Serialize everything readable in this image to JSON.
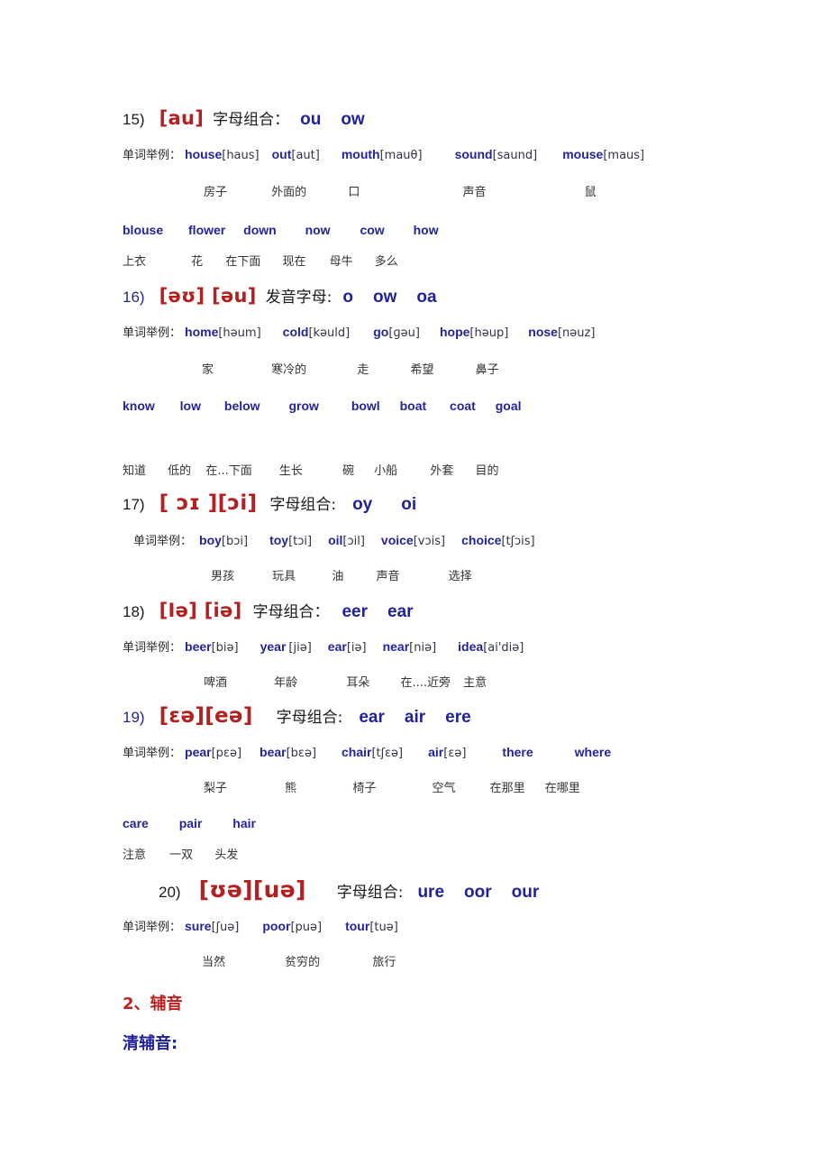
{
  "document": {
    "title": "英语音标 — 元音字母组合与辅音",
    "page_background": "#ffffff",
    "colors": {
      "ipa_red": "#b42020",
      "combo_blue": "#21219b",
      "word_blue": "#242498",
      "heading_red": "#c01f1f",
      "heading_blue": "#21219b",
      "gloss_gray": "#333333"
    },
    "examples_label": "单词举例："
  },
  "sections": [
    {
      "number": "15)",
      "number_color": "black",
      "ipa": "[au]",
      "label": "字母组合：",
      "combos": [
        "ou",
        "ow"
      ],
      "examples": [
        {
          "word": "house",
          "ipa": "[haus]"
        },
        {
          "word": "out",
          "ipa": "[aut]"
        },
        {
          "word": "mouth",
          "ipa": "[mauθ]"
        },
        {
          "word": "sound",
          "ipa": "[saund]"
        },
        {
          "word": "mouse",
          "ipa": "[maus]"
        }
      ],
      "glosses": [
        "房子",
        "外面的",
        "口",
        "声音",
        "鼠"
      ],
      "extra_words": [
        "blouse",
        "flower",
        "down",
        "now",
        "cow",
        "how"
      ],
      "extra_glosses": [
        "上衣",
        "花",
        "在下面",
        "现在",
        "母牛",
        "多么"
      ]
    },
    {
      "number": "16)",
      "number_color": "blue",
      "ipa": "[əʊ] [əu]",
      "label": "发音字母:",
      "combos": [
        "o",
        "ow",
        "oa"
      ],
      "examples": [
        {
          "word": "home",
          "ipa": "[həum]"
        },
        {
          "word": "cold",
          "ipa": "[kəuld]"
        },
        {
          "word": "go",
          "ipa": "[ɡəu]"
        },
        {
          "word": "hope",
          "ipa": "[həup]"
        },
        {
          "word": "nose",
          "ipa": "[nəuz]"
        }
      ],
      "glosses": [
        "家",
        "寒冷的",
        "走",
        "希望",
        "鼻子"
      ],
      "extra_words": [
        "know",
        "low",
        "below",
        "grow",
        "bowl",
        "boat",
        "coat",
        "goal"
      ],
      "extra_glosses": [
        "知道",
        "低的",
        "在...下面",
        "生长",
        "碗",
        "小船",
        "外套",
        "目的"
      ]
    },
    {
      "number": "17)",
      "number_color": "black",
      "ipa": "[ ɔɪ ][ɔi]",
      "label": "字母组合:",
      "combos": [
        "oy",
        "oi"
      ],
      "examples": [
        {
          "word": "boy",
          "ipa": "[bɔi]"
        },
        {
          "word": "toy",
          "ipa": "[tɔi]"
        },
        {
          "word": "oil",
          "ipa": "[ɔil]"
        },
        {
          "word": "voice",
          "ipa": "[vɔis]"
        },
        {
          "word": "choice",
          "ipa": "[tʃɔis]"
        }
      ],
      "glosses": [
        "男孩",
        "玩具",
        "油",
        "声音",
        "选择"
      ],
      "extra_words": [],
      "extra_glosses": []
    },
    {
      "number": "18)",
      "number_color": "black",
      "ipa": "[Iə] [iə]",
      "label": "字母组合：",
      "combos": [
        "eer",
        "ear"
      ],
      "examples": [
        {
          "word": "beer",
          "ipa": "[biə]"
        },
        {
          "word": "year",
          "ipa": "[jiə]"
        },
        {
          "word": "ear",
          "ipa": "[iə]"
        },
        {
          "word": "near",
          "ipa": "[niə]"
        },
        {
          "word": "idea",
          "ipa": "[ai'diə]"
        }
      ],
      "glosses": [
        "啤酒",
        "年龄",
        "耳朵",
        "在....近旁",
        "主意"
      ],
      "extra_words": [],
      "extra_glosses": []
    },
    {
      "number": "19)",
      "number_color": "blue",
      "ipa": "[ɛə][eə]",
      "label": "字母组合:",
      "combos": [
        "ear",
        "air",
        "ere"
      ],
      "examples": [
        {
          "word": "pear",
          "ipa": "[pɛə]"
        },
        {
          "word": "bear",
          "ipa": "[bɛə]"
        },
        {
          "word": "chair",
          "ipa": "[tʃɛə]"
        },
        {
          "word": "air",
          "ipa": "[ɛə]"
        },
        {
          "word": "there",
          "ipa": ""
        },
        {
          "word": "where",
          "ipa": ""
        }
      ],
      "glosses": [
        "梨子",
        "熊",
        "椅子",
        "空气",
        "在那里",
        "在哪里"
      ],
      "extra_words": [
        "care",
        "pair",
        "hair"
      ],
      "extra_glosses": [
        "注意",
        "一双",
        "头发"
      ]
    },
    {
      "number": "20)",
      "number_color": "black",
      "ipa": "[ʊə][uə]",
      "label": "字母组合:",
      "combos": [
        "ure",
        "oor",
        "our"
      ],
      "examples": [
        {
          "word": "sure",
          "ipa": "[ʃuə]"
        },
        {
          "word": "poor",
          "ipa": "[puə]"
        },
        {
          "word": "tour",
          "ipa": "[tuə]"
        }
      ],
      "glosses": [
        "当然",
        "贫穷的",
        "旅行"
      ],
      "extra_words": [],
      "extra_glosses": []
    }
  ],
  "footer": {
    "consonant_heading": "2、辅音",
    "voiceless_heading": "清辅音:"
  }
}
